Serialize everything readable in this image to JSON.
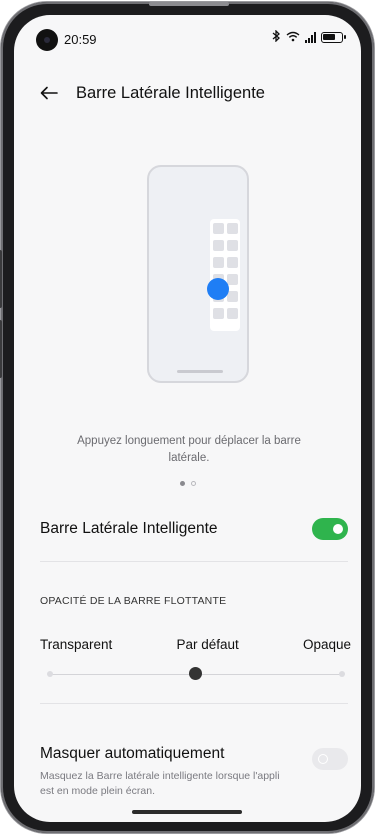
{
  "status_bar": {
    "time": "20:59"
  },
  "header": {
    "title": "Barre Latérale Intelligente"
  },
  "illustration": {
    "hint": "Appuyez longuement pour déplacer la barre latérale.",
    "page_count": 2,
    "active_page": 1
  },
  "sidebar_toggle": {
    "label": "Barre Latérale Intelligente",
    "enabled": true,
    "on_color": "#2fb44d"
  },
  "opacity": {
    "section_title": "OPACITÉ DE LA BARRE FLOTTANTE",
    "options": [
      "Transparent",
      "Par défaut",
      "Opaque"
    ],
    "selected": "Par défaut"
  },
  "auto_hide": {
    "title": "Masquer automatiquement",
    "description": "Masquez la Barre latérale intelligente lorsque l'appli est en mode plein écran.",
    "enabled": false
  },
  "colors": {
    "accent_blue": "#1f7ef5",
    "background": "#f7f7f8"
  }
}
